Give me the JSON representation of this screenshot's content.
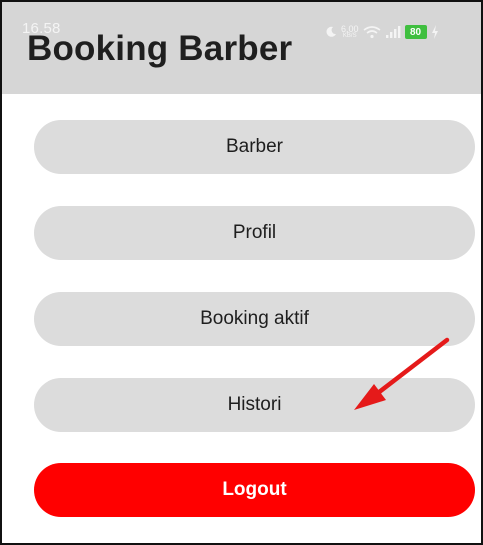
{
  "status_bar": {
    "time": "16.58",
    "speed_value": "6,00",
    "speed_unit": "KB/S",
    "battery": "80",
    "icons": [
      "moon-icon",
      "wifi-icon",
      "signal-icon",
      "battery-icon",
      "charging-icon"
    ]
  },
  "app_bar": {
    "title": "Booking Barber"
  },
  "menu": {
    "barber": "Barber",
    "profil": "Profil",
    "booking_aktif": "Booking aktif",
    "histori": "Histori",
    "logout": "Logout"
  },
  "colors": {
    "app_bar": "#d6d6d6",
    "button": "#dcdcdc",
    "logout_button": "#ff0000",
    "arrow": "#e51a1a",
    "battery": "#3fbf3f"
  }
}
